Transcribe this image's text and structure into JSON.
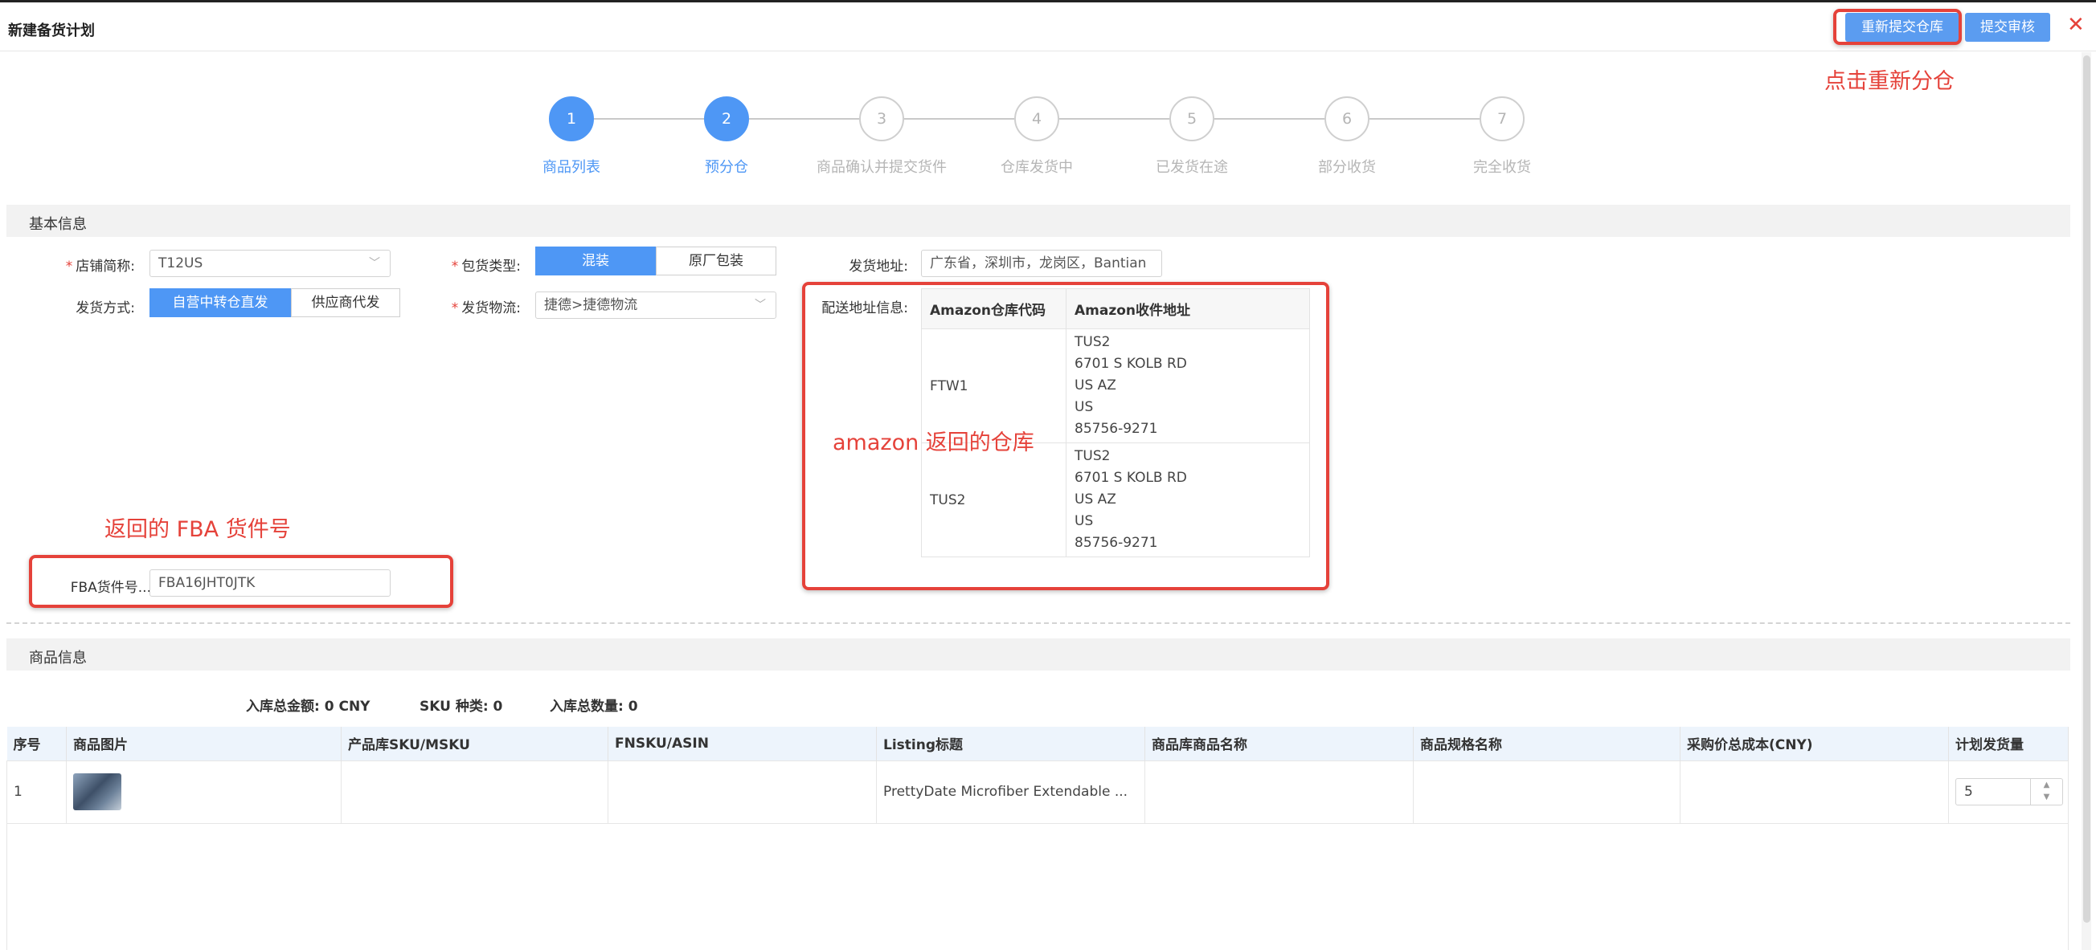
{
  "header": {
    "title": "新建备货计划",
    "resubmit_label": "重新提交仓库",
    "submit_review_label": "提交审核",
    "close_glyph": "✕"
  },
  "annotations": {
    "redistribute": "点击重新分仓",
    "amazon_warehouse": "amazon 返回的仓库",
    "fba_number": "返回的 FBA 货件号"
  },
  "steps": [
    {
      "number": "1",
      "label": "商品列表",
      "active": true
    },
    {
      "number": "2",
      "label": "预分仓",
      "active": true
    },
    {
      "number": "3",
      "label": "商品确认并提交货件",
      "active": false
    },
    {
      "number": "4",
      "label": "仓库发货中",
      "active": false
    },
    {
      "number": "5",
      "label": "已发货在途",
      "active": false
    },
    {
      "number": "6",
      "label": "部分收货",
      "active": false
    },
    {
      "number": "7",
      "label": "完全收货",
      "active": false
    }
  ],
  "basic_info": {
    "section_title": "基本信息",
    "shop_label": "店铺简称:",
    "shop_value": "T12US",
    "packing_label": "包货类型:",
    "packing_options": [
      "混装",
      "原厂包装"
    ],
    "ship_address_label": "发货地址:",
    "ship_address_value": "广东省，深圳市，龙岗区，Bantian",
    "ship_method_label": "发货方式:",
    "ship_method_options": [
      "自营中转仓直发",
      "供应商代发"
    ],
    "logistics_label": "发货物流:",
    "logistics_value": "捷德>捷德物流",
    "delivery_info_label": "配送地址信息:",
    "warehouse_table": {
      "headers": [
        "Amazon仓库代码",
        "Amazon收件地址"
      ],
      "rows": [
        {
          "code": "FTW1",
          "lines": [
            "TUS2",
            "6701 S KOLB RD",
            "US AZ",
            "US",
            "85756-9271"
          ]
        },
        {
          "code": "TUS2",
          "lines": [
            "TUS2",
            "6701 S KOLB RD",
            "US AZ",
            "US",
            "85756-9271"
          ]
        }
      ]
    },
    "fba_label": "FBA货件号...",
    "fba_value": "FBA16JHT0JTK"
  },
  "product_info": {
    "section_title": "商品信息",
    "total_amount": "入库总金额: 0 CNY",
    "sku_count": "SKU 种类: 0",
    "total_qty": "入库总数量: 0",
    "columns": [
      "序号",
      "商品图片",
      "产品库SKU/MSKU",
      "FNSKU/ASIN",
      "Listing标题",
      "商品库商品名称",
      "商品规格名称",
      "采购价总成本(CNY)",
      "计划发货量"
    ],
    "rows": [
      {
        "index": "1",
        "sku": "",
        "fnsku": "",
        "listing": "PrettyDate Microfiber Extendable ...",
        "product_name": "",
        "spec_name": "",
        "cost": "",
        "plan_qty": "5"
      }
    ]
  },
  "colors": {
    "accent": "#4e97f5",
    "annotation_red": "#e5423a"
  }
}
